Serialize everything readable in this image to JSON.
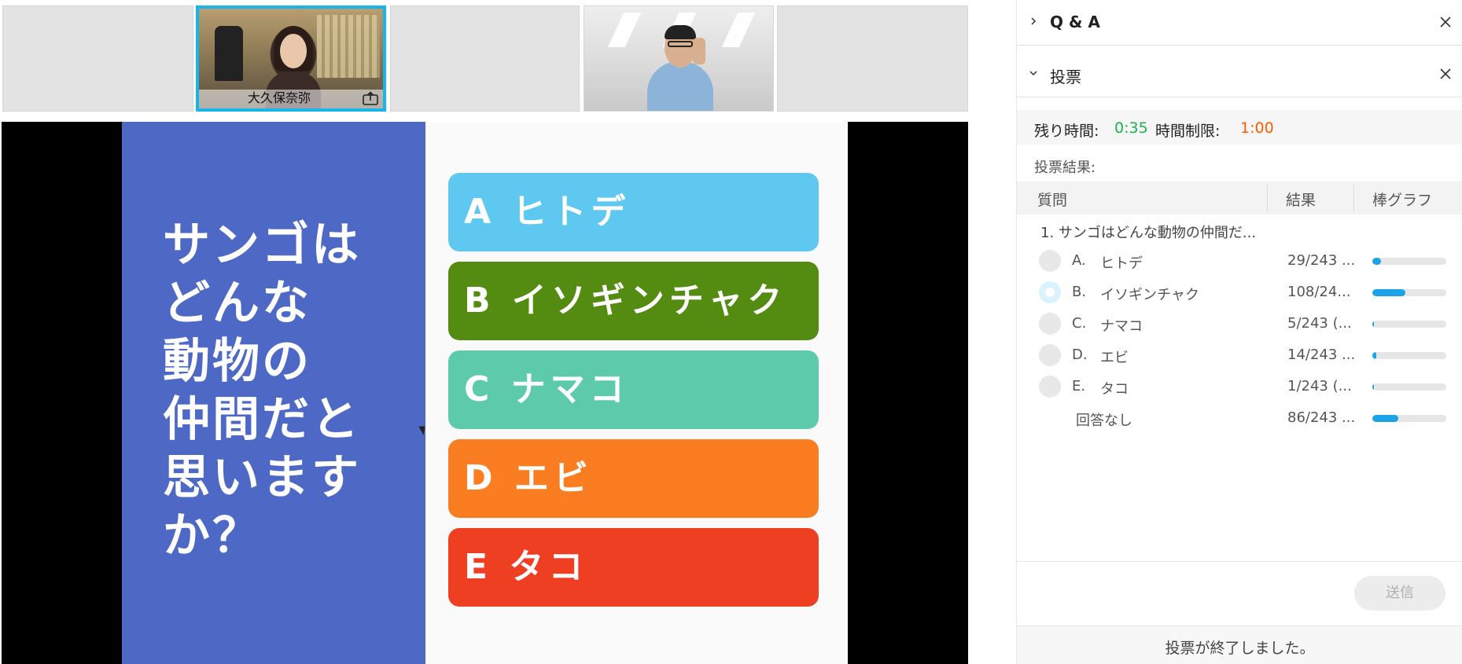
{
  "video_strip": {
    "participants": [
      {
        "name": ""
      },
      {
        "name": "大久保奈弥",
        "active": true,
        "sharing": true
      },
      {
        "name": ""
      },
      {
        "name": ""
      },
      {
        "name": ""
      }
    ]
  },
  "slide": {
    "question": "サンゴは\nどんな\n動物の\n仲間だと\n思います\nか？",
    "options": [
      {
        "text": "A ヒトデ",
        "color": "#5ec8f0"
      },
      {
        "text": "B イソギンチャク",
        "color": "#548b11"
      },
      {
        "text": "C ナマコ",
        "color": "#5dcbab"
      },
      {
        "text": "D エビ",
        "color": "#fb7d22"
      },
      {
        "text": "E タコ",
        "color": "#ee3f22"
      }
    ]
  },
  "panel": {
    "qa": {
      "title": "Q & A"
    },
    "poll": {
      "title": "投票",
      "remaining_label": "残り時間:",
      "remaining_value": "0:35",
      "limit_label": "時間制限:",
      "limit_value": "1:00",
      "results_label": "投票結果:",
      "columns": {
        "question": "質問",
        "result": "結果",
        "bar": "棒グラフ"
      },
      "question_text": "1.  サンゴはどんな動物の仲間だ...",
      "answers": [
        {
          "letter": "A.",
          "text": "ヒトデ",
          "result": "29/243 ...",
          "fraction": 0.119,
          "selected": false
        },
        {
          "letter": "B.",
          "text": "イソギンチャク",
          "result": "108/24...",
          "fraction": 0.444,
          "selected": true
        },
        {
          "letter": "C.",
          "text": "ナマコ",
          "result": "5/243 (...",
          "fraction": 0.021,
          "selected": false
        },
        {
          "letter": "D.",
          "text": "エビ",
          "result": "14/243 ...",
          "fraction": 0.058,
          "selected": false
        },
        {
          "letter": "E.",
          "text": "タコ",
          "result": "1/243 (...",
          "fraction": 0.004,
          "selected": false
        }
      ],
      "no_answer": {
        "text": "回答なし",
        "result": "86/243 ...",
        "fraction": 0.354
      },
      "submit_label": "送信",
      "status": "投票が終了しました。"
    }
  },
  "colors": {
    "accent": "#17b5ea",
    "bar": "#1aa3e6",
    "remaining": "#1fb24b",
    "limit": "#ff5a00",
    "slide_left": "#4e68c6"
  }
}
